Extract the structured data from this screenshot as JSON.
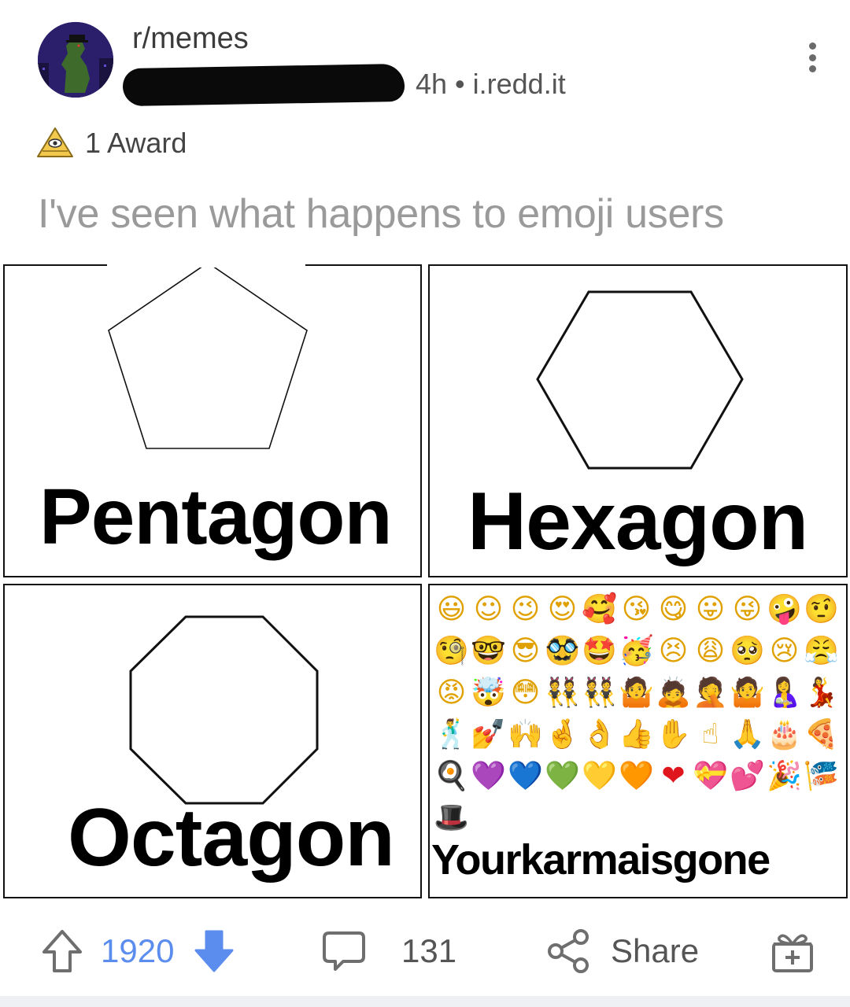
{
  "post": {
    "subreddit": "r/memes",
    "author_redacted": true,
    "meta": "4h • i.redd.it",
    "awards": "1 Award",
    "title": "I've seen what happens to emoji users"
  },
  "meme": {
    "panels": [
      {
        "label": "Pentagon",
        "shape": "pentagon"
      },
      {
        "label": "Hexagon",
        "shape": "hexagon"
      },
      {
        "label": "Octagon",
        "shape": "octagon"
      },
      {
        "label": "Yourkarmaisgone",
        "shape": "emoji-grid"
      }
    ],
    "emojis": [
      "😃",
      "☺",
      "😉",
      "😍",
      "🥰",
      "😘",
      "😋",
      "😛",
      "😜",
      "🤪",
      "🤨",
      "🧐",
      "🤓",
      "😎",
      "🥸",
      "🤩",
      "🥳",
      "😣",
      "😩",
      "🥺",
      "😢",
      "😤",
      "😡",
      "🤯",
      "😳",
      "👯",
      "👯",
      "🤷",
      "🙇",
      "🤦",
      "🤷",
      "🤱",
      "💃",
      "🕺",
      "💅",
      "🙌",
      "🤞",
      "👌",
      "👍",
      "✋",
      "☝",
      "🙏",
      "🎂",
      "🍕",
      "🍳",
      "💜",
      "💙",
      "💚",
      "💛",
      "🧡",
      "❤",
      "💝",
      "💕",
      "🎉",
      "🎏",
      "🎩"
    ]
  },
  "actions": {
    "upvotes": "1920",
    "comments": "131",
    "share": "Share"
  },
  "colors": {
    "vote_blue": "#5b8dee",
    "title_gray": "#9a9a9a",
    "award_gold": "#f2c94c"
  },
  "icons": [
    "more-vertical-icon",
    "award-icon",
    "upvote-icon",
    "downvote-icon",
    "comment-icon",
    "share-icon",
    "gift-icon"
  ]
}
